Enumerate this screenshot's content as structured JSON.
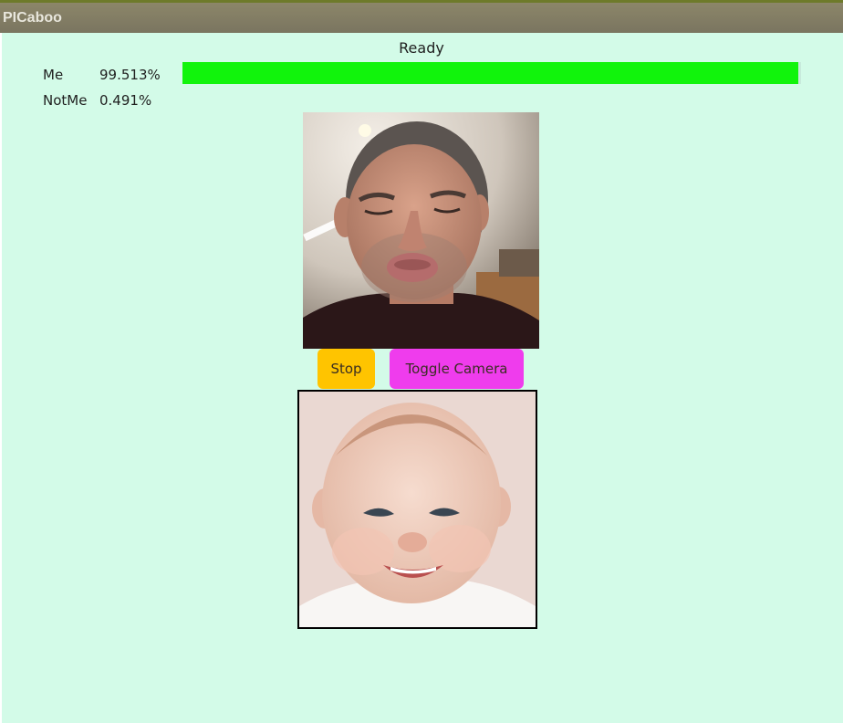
{
  "app": {
    "title": "PICaboo"
  },
  "status": {
    "text": "Ready"
  },
  "results": {
    "me": {
      "label": "Me",
      "value": "99.513%",
      "fraction": 0.99513
    },
    "notme": {
      "label": "NotMe",
      "value": "0.491%",
      "fraction": 0.00491
    }
  },
  "controls": {
    "stop_label": "Stop",
    "toggle_camera_label": "Toggle Camera"
  },
  "colors": {
    "background": "#d3fbe8",
    "progress": "#11f40c",
    "stop_button": "#ffc400",
    "toggle_button": "#ef3ced"
  }
}
